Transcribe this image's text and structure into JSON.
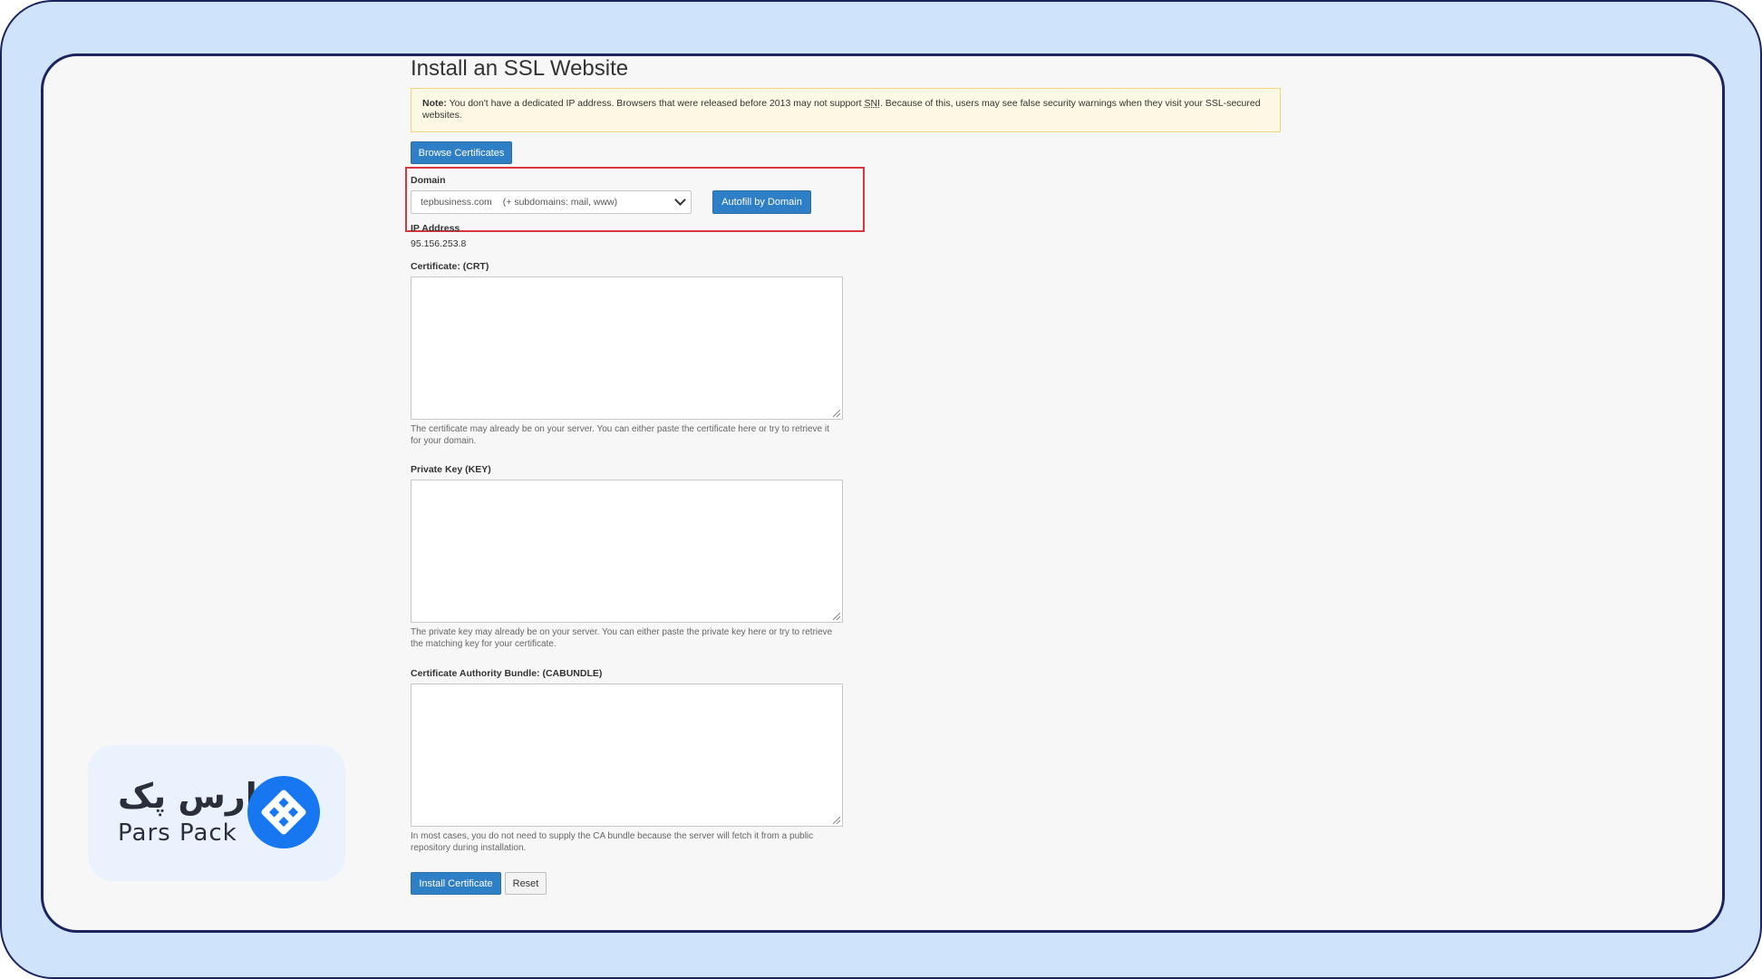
{
  "page": {
    "title": "Install an SSL Website"
  },
  "note": {
    "label": "Note:",
    "text_before_sni": " You don't have a dedicated IP address. Browsers that were released before 2013 may not support ",
    "sni": "SNI",
    "text_after_sni": ". Because of this, users may see false security warnings when they visit your SSL-secured websites."
  },
  "buttons": {
    "browse_certificates": "Browse Certificates",
    "autofill_by_domain": "Autofill by Domain",
    "install_certificate": "Install Certificate",
    "reset": "Reset"
  },
  "domain": {
    "label": "Domain",
    "selected_domain": "tepbusiness.com",
    "selected_subdomains": "(+ subdomains: mail, www)"
  },
  "ip_address": {
    "label": "IP Address",
    "value": "95.156.253.8"
  },
  "certificate": {
    "label": "Certificate: (CRT)",
    "value": "",
    "help": "The certificate may already be on your server. You can either paste the certificate here or try to retrieve it for your domain."
  },
  "private_key": {
    "label": "Private Key (KEY)",
    "value": "",
    "help": "The private key may already be on your server. You can either paste the private key here or try to retrieve the matching key for your certificate."
  },
  "cabundle": {
    "label": "Certificate Authority Bundle: (CABUNDLE)",
    "value": "",
    "help": "In most cases, you do not need to supply the CA bundle because the server will fetch it from a public repository during installation."
  },
  "logo": {
    "text_fa": "پارس پک",
    "text_en": "Pars Pack",
    "icon": "pars-pack-diamond-logo"
  },
  "colors": {
    "outer_background": "#cfe3fb",
    "frame_border": "#1c2460",
    "primary_button": "#2f7fc7",
    "highlight": "#d9363e",
    "note_background": "#fcf8e3",
    "logo_blue": "#1677f0"
  }
}
